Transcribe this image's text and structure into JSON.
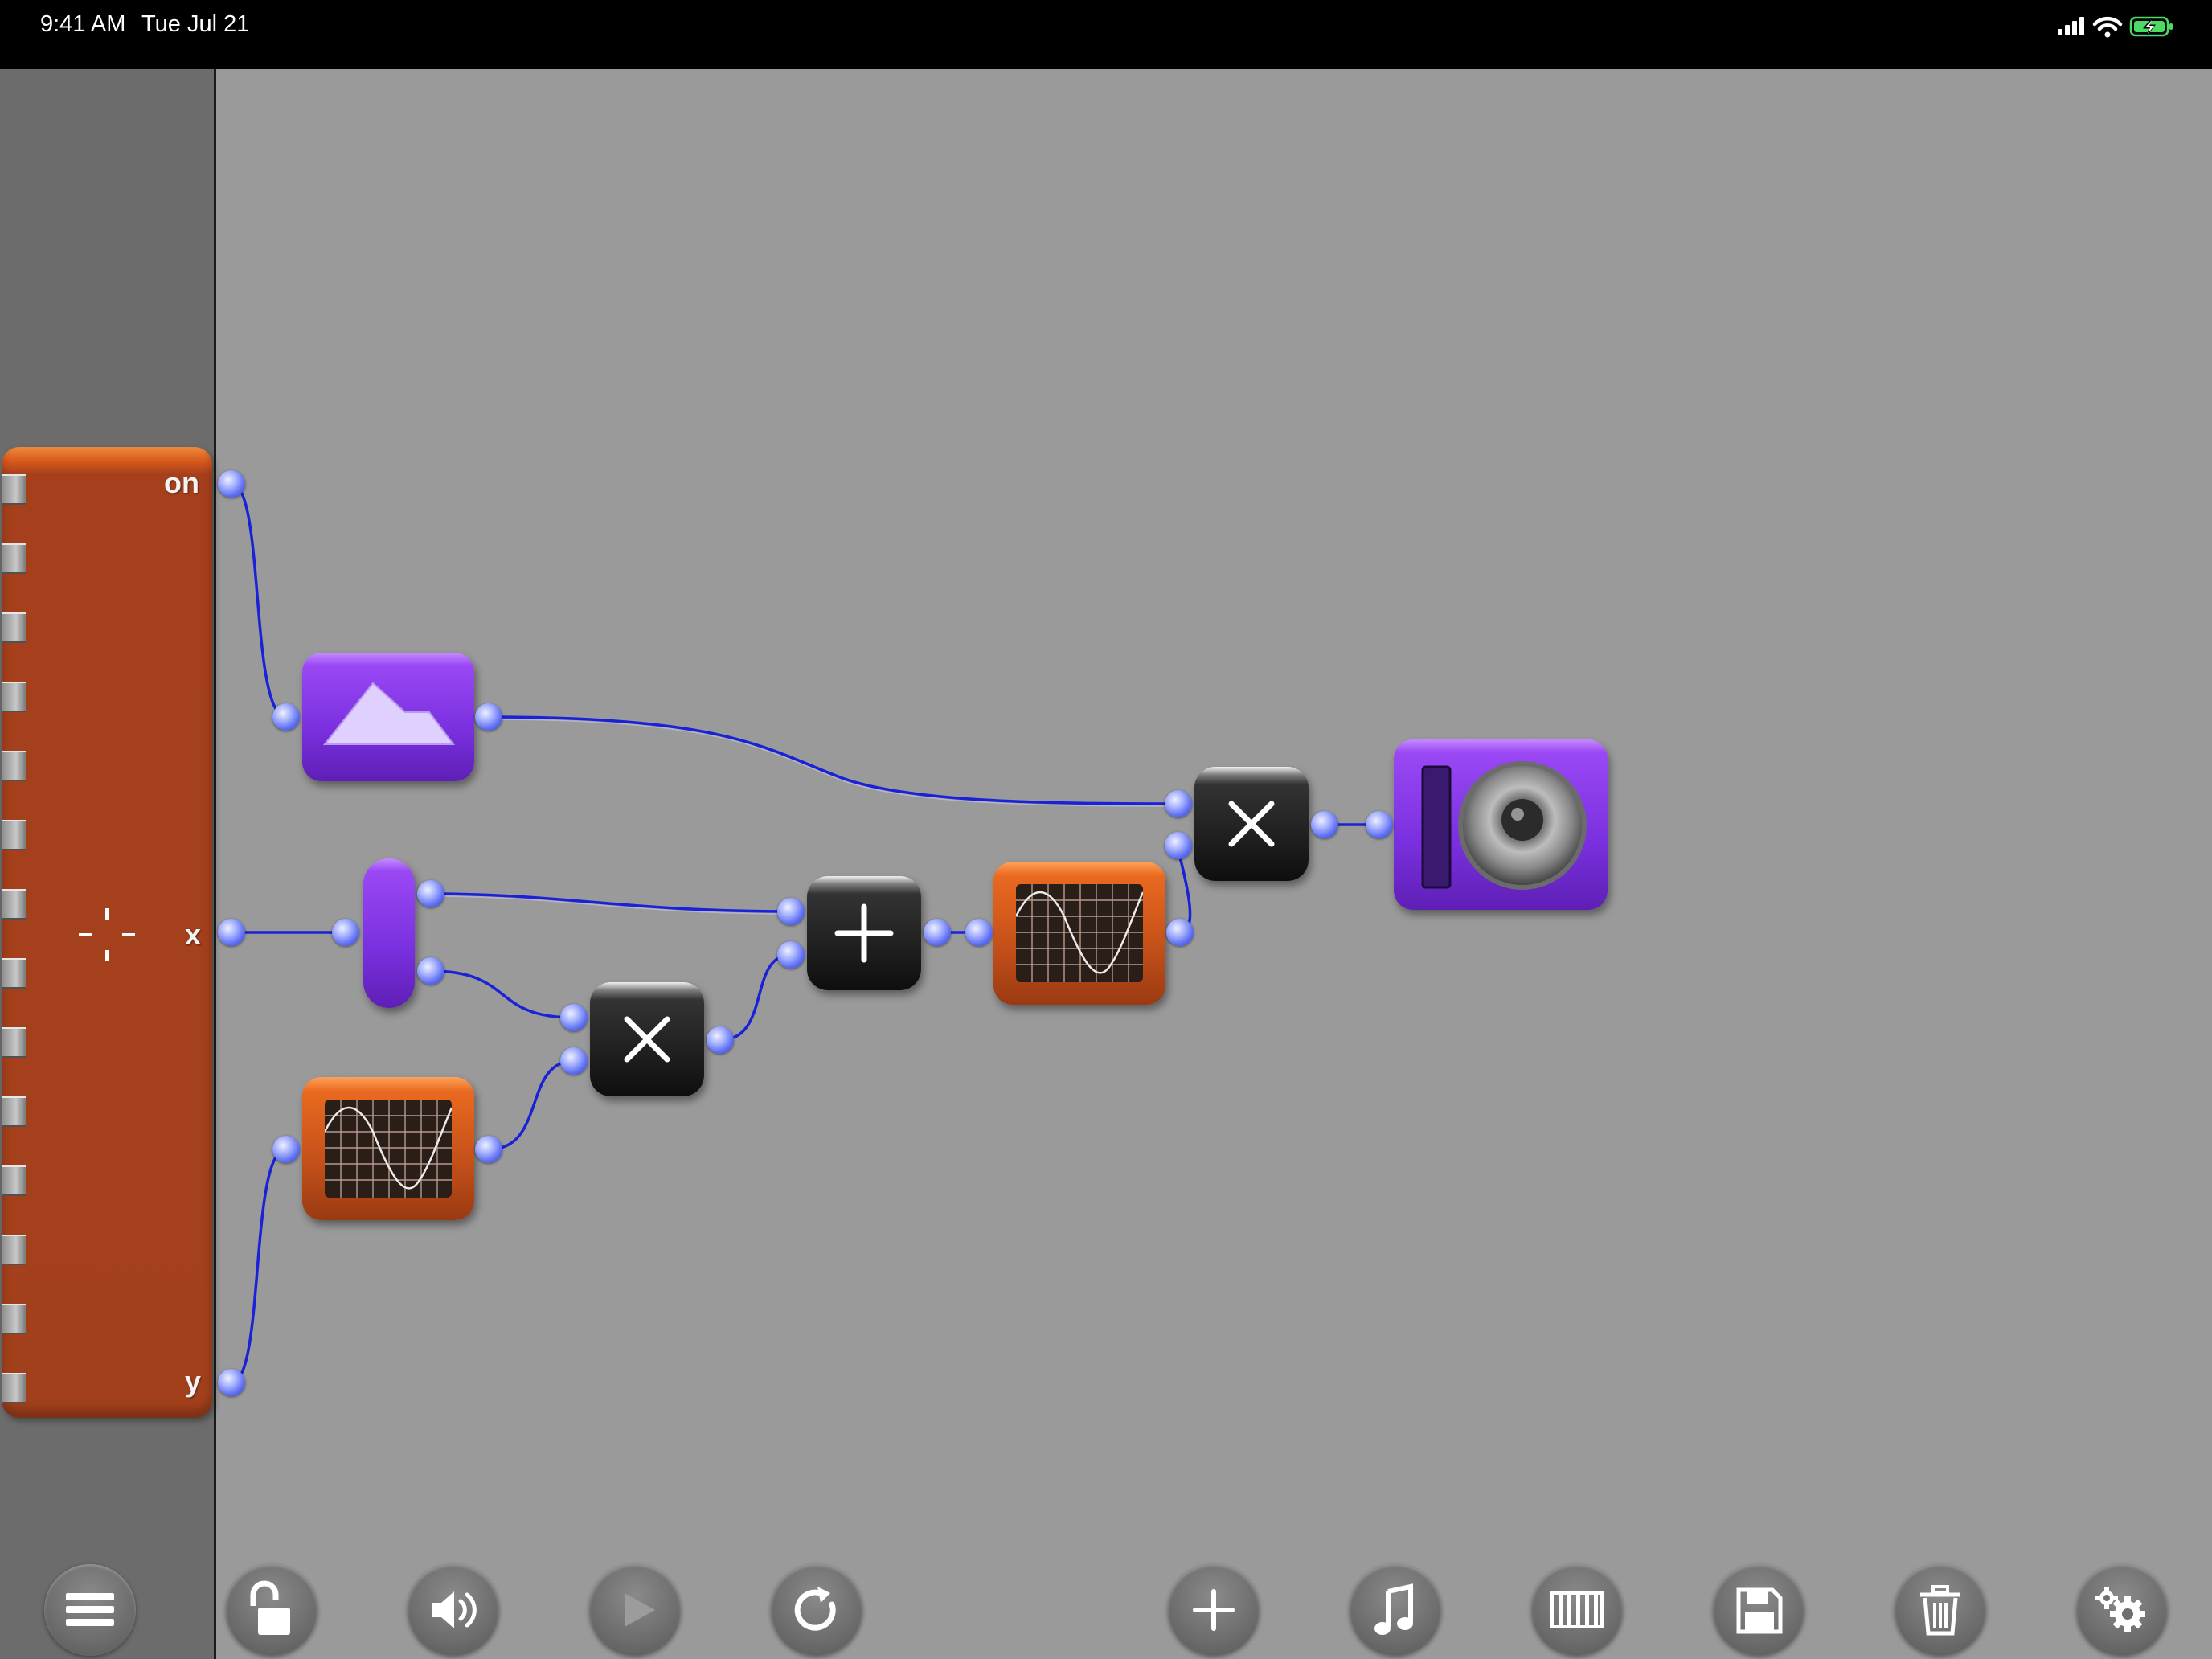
{
  "status_bar": {
    "time": "9:41 AM",
    "date": "Tue Jul 21",
    "battery": "charging",
    "wifi": "full",
    "signal": "full"
  },
  "xy_pad": {
    "labels": {
      "on": "on",
      "x": "x",
      "y": "y"
    }
  },
  "modules": [
    {
      "id": "envelope",
      "icon": "envelope-icon",
      "color": "#7a30df"
    },
    {
      "id": "splitter",
      "icon": "splitter",
      "color": "#7a30df"
    },
    {
      "id": "oscillator-1",
      "icon": "sine-scope-icon",
      "color": "#e9691f"
    },
    {
      "id": "multiply-1",
      "icon": "multiply-icon",
      "color": "#1c1c1c"
    },
    {
      "id": "add",
      "icon": "plus-icon",
      "color": "#1c1c1c"
    },
    {
      "id": "oscillator-2",
      "icon": "sine-scope-icon",
      "color": "#e9691f"
    },
    {
      "id": "multiply-2",
      "icon": "multiply-icon",
      "color": "#1c1c1c"
    },
    {
      "id": "output",
      "icon": "speaker-icon",
      "color": "#7a30df"
    }
  ],
  "wire_color": "#1a22d8",
  "toolbar": [
    {
      "id": "menu",
      "icon": "hamburger-menu-icon"
    },
    {
      "id": "lock",
      "icon": "unlock-icon"
    },
    {
      "id": "volume",
      "icon": "speaker-volume-icon"
    },
    {
      "id": "play",
      "icon": "play-icon"
    },
    {
      "id": "reload",
      "icon": "reload-icon"
    },
    {
      "id": "add",
      "icon": "plus-icon"
    },
    {
      "id": "music",
      "icon": "music-note-icon"
    },
    {
      "id": "keyboard",
      "icon": "piano-keyboard-icon"
    },
    {
      "id": "save",
      "icon": "floppy-disk-icon"
    },
    {
      "id": "delete",
      "icon": "trash-icon"
    },
    {
      "id": "settings",
      "icon": "gears-icon"
    }
  ]
}
